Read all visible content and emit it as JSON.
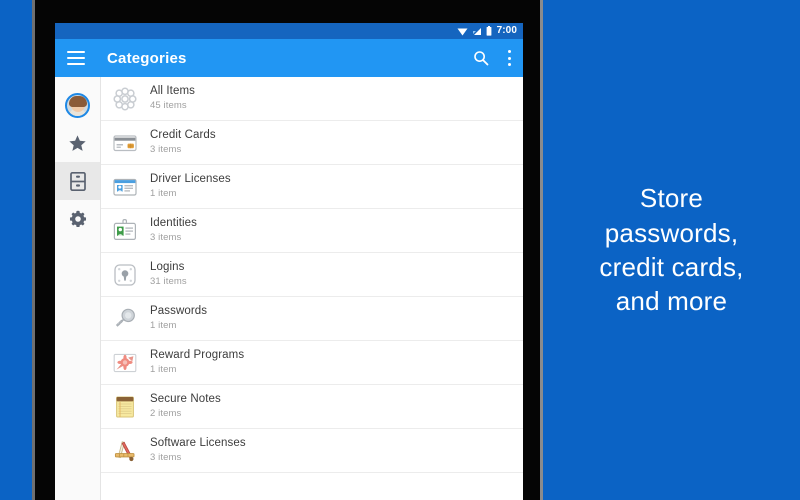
{
  "promo": {
    "text": "Store\npasswords,\ncredit cards,\nand more",
    "bg_color": "#0b63c5"
  },
  "statusbar": {
    "time": "7:00",
    "icons": [
      "wifi-icon",
      "cellular-signal-icon",
      "battery-icon"
    ],
    "bg_color": "#1565bf"
  },
  "appbar": {
    "menu_icon": "hamburger-menu-icon",
    "title": "Categories",
    "search_icon": "search-icon",
    "overflow_icon": "overflow-menu-icon",
    "bg_color": "#2196f3"
  },
  "rail": {
    "items": [
      {
        "name": "account-avatar",
        "icon": "avatar-icon",
        "selected": false
      },
      {
        "name": "favorites",
        "icon": "star-icon",
        "selected": false
      },
      {
        "name": "categories",
        "icon": "categories-icon",
        "selected": true
      },
      {
        "name": "settings",
        "icon": "gear-icon",
        "selected": false
      }
    ]
  },
  "list": {
    "items": [
      {
        "title": "All Items",
        "count": "45 items",
        "icon": "all-items-icon"
      },
      {
        "title": "Credit Cards",
        "count": "3 items",
        "icon": "credit-card-icon"
      },
      {
        "title": "Driver Licenses",
        "count": "1 item",
        "icon": "driver-license-icon"
      },
      {
        "title": "Identities",
        "count": "3 items",
        "icon": "identity-badge-icon"
      },
      {
        "title": "Logins",
        "count": "31 items",
        "icon": "login-keyhole-icon"
      },
      {
        "title": "Passwords",
        "count": "1 item",
        "icon": "password-key-icon"
      },
      {
        "title": "Reward Programs",
        "count": "1 item",
        "icon": "reward-rosette-icon"
      },
      {
        "title": "Secure Notes",
        "count": "2 items",
        "icon": "secure-note-icon"
      },
      {
        "title": "Software Licenses",
        "count": "3 items",
        "icon": "software-license-icon"
      }
    ]
  }
}
